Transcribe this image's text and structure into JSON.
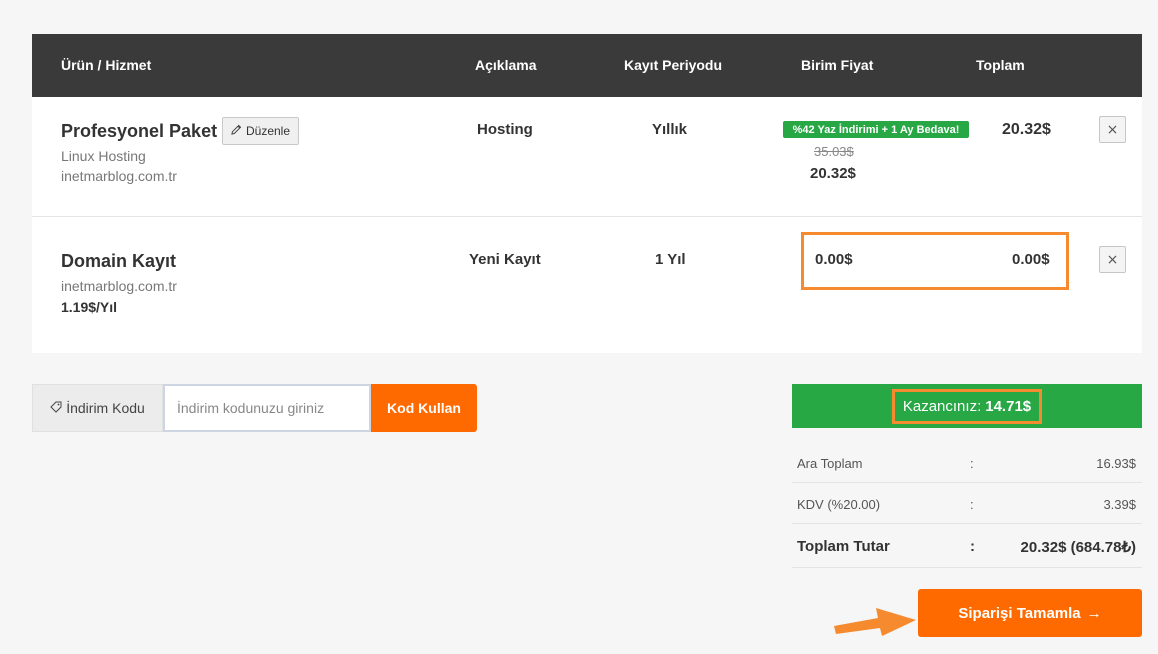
{
  "header": {
    "product": "Ürün / Hizmet",
    "description": "Açıklama",
    "period": "Kayıt Periyodu",
    "unit_price": "Birim Fiyat",
    "total": "Toplam"
  },
  "items": [
    {
      "name": "Profesyonel Paket",
      "edit_label": "Düzenle",
      "line1": "Linux Hosting",
      "line2": "inetmarblog.com.tr",
      "description": "Hosting",
      "period": "Yıllık",
      "promo": "%42 Yaz İndirimi + 1 Ay Bedava!",
      "old_price": "35.03$",
      "unit_price": "20.32$",
      "total": "20.32$",
      "remove": "×"
    },
    {
      "name": "Domain Kayıt",
      "line1": "inetmarblog.com.tr",
      "line2": "1.19$/Yıl",
      "description": "Yeni Kayıt",
      "period": "1 Yıl",
      "unit_price": "0.00$",
      "total": "0.00$",
      "remove": "×"
    }
  ],
  "coupon": {
    "label": "İndirim Kodu",
    "placeholder": "İndirim kodunuzu giriniz",
    "button": "Kod Kullan"
  },
  "savings": {
    "label": "Kazancınız:",
    "amount": "14.71$"
  },
  "totals": {
    "subtotal_label": "Ara Toplam",
    "subtotal_value": "16.93$",
    "tax_label": "KDV (%20.00)",
    "tax_value": "3.39$",
    "grand_label": "Toplam Tutar",
    "grand_value": "20.32$ (684.78₺)",
    "separator": ":"
  },
  "checkout": {
    "label": "Siparişi Tamamla",
    "arrow": "→"
  },
  "colors": {
    "accent_orange": "#ff6a00",
    "success_green": "#28a745",
    "header_dark": "#3a3a3a",
    "highlight_orange": "#f58a2e"
  }
}
